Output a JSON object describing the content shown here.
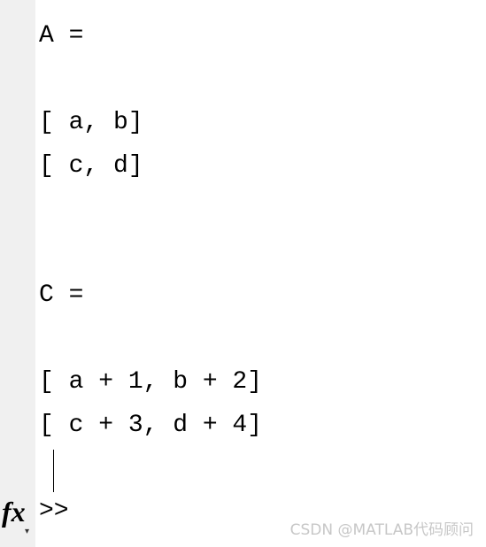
{
  "console": {
    "lines": [
      "A =",
      "[ a, b]",
      "[ c, d]",
      "C =",
      "[ a + 1, b + 2]",
      "[ c + 3, d + 4]"
    ],
    "prompt": ">>",
    "fx_icon_label": "fx",
    "fx_dot": "▾"
  },
  "watermark": "CSDN @MATLAB代码顾问"
}
